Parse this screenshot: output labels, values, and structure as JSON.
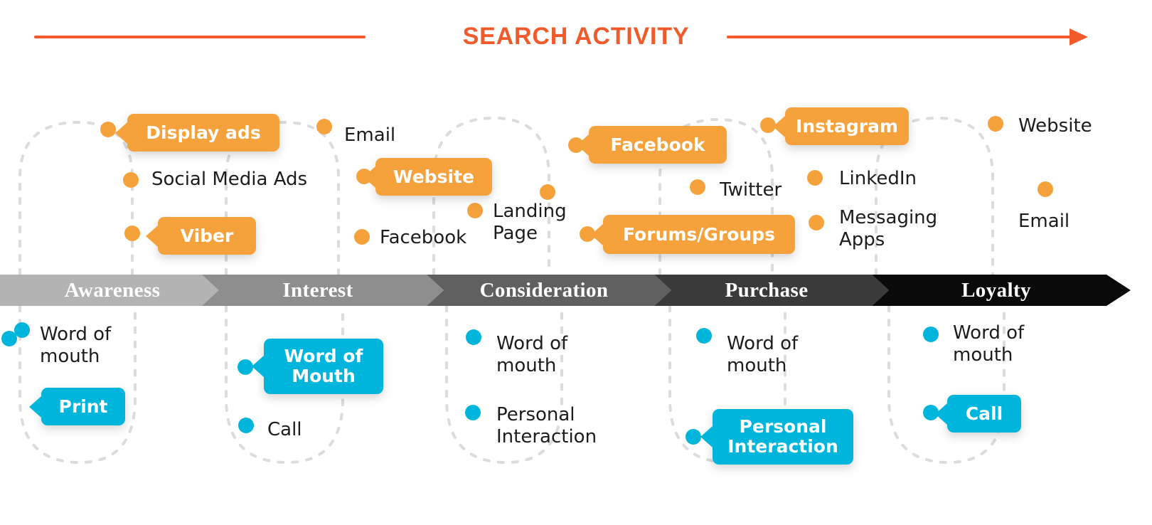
{
  "header": {
    "title": "SEARCH ACTIVITY",
    "accent_color": "#F15B2B",
    "arrow_icon": "right-arrow-icon"
  },
  "colors": {
    "orange": "#F5A23C",
    "cyan": "#00B5DC",
    "title": "#F15B2B",
    "dotted_line": "#DCDCDC"
  },
  "funnel": {
    "stages": [
      {
        "label": "Awareness",
        "color": "#B3B3B3"
      },
      {
        "label": "Interest",
        "color": "#8E8E8E"
      },
      {
        "label": "Consideration",
        "color": "#606060"
      },
      {
        "label": "Purchase",
        "color": "#3A3A3A"
      },
      {
        "label": "Loyalty",
        "color": "#0A0A0A"
      }
    ]
  },
  "chart_data": {
    "type": "diagram",
    "title": "SEARCH ACTIVITY",
    "description": "Customer journey funnel mapping online (above the bar) and offline (below the bar) touchpoints across five stages.",
    "stages": [
      "Awareness",
      "Interest",
      "Consideration",
      "Purchase",
      "Loyalty"
    ],
    "online_touchpoints": {
      "Awareness": [
        "Display ads",
        "Social Media Ads",
        "Viber"
      ],
      "Interest": [
        "Email",
        "Website",
        "Facebook"
      ],
      "Consideration": [
        "Landing Page",
        "Facebook",
        "Forums/Groups"
      ],
      "Purchase": [
        "Twitter",
        "Instagram",
        "LinkedIn",
        "Messaging Apps"
      ],
      "Loyalty": [
        "Website",
        "Email"
      ]
    },
    "offline_touchpoints": {
      "Awareness": [
        "Word of mouth",
        "Print"
      ],
      "Interest": [
        "Word of Mouth",
        "Call"
      ],
      "Consideration": [
        "Word of mouth",
        "Personal Interaction"
      ],
      "Purchase": [
        "Word of mouth",
        "Personal Interaction"
      ],
      "Loyalty": [
        "Word of mouth",
        "Call"
      ]
    },
    "highlighted_online": [
      "Display ads",
      "Viber",
      "Website",
      "Facebook",
      "Forums/Groups",
      "Instagram"
    ],
    "highlighted_offline": [
      "Print",
      "Word of Mouth",
      "Personal Interaction",
      "Call"
    ]
  },
  "top": {
    "labels": [
      {
        "id": "social-media-ads",
        "text": "Social Media Ads"
      },
      {
        "id": "email-interest",
        "text": "Email"
      },
      {
        "id": "facebook-interest",
        "text": "Facebook"
      },
      {
        "id": "landing-page",
        "text": "Landing\nPage"
      },
      {
        "id": "twitter",
        "text": "Twitter"
      },
      {
        "id": "linkedin",
        "text": "LinkedIn"
      },
      {
        "id": "messaging-apps",
        "text": "Messaging\nApps"
      },
      {
        "id": "website-loyalty",
        "text": "Website"
      },
      {
        "id": "email-loyalty",
        "text": "Email"
      }
    ],
    "pills": [
      {
        "id": "display-ads",
        "text": "Display ads"
      },
      {
        "id": "viber",
        "text": "Viber"
      },
      {
        "id": "website",
        "text": "Website"
      },
      {
        "id": "facebook",
        "text": "Facebook"
      },
      {
        "id": "forums-groups",
        "text": "Forums/Groups"
      },
      {
        "id": "instagram",
        "text": "Instagram"
      }
    ]
  },
  "bottom": {
    "labels": [
      {
        "id": "wom-awareness",
        "text": "Word of\nmouth"
      },
      {
        "id": "call-interest",
        "text": "Call"
      },
      {
        "id": "wom-consideration",
        "text": "Word of\nmouth"
      },
      {
        "id": "personal-interaction-consideration",
        "text": "Personal\nInteraction"
      },
      {
        "id": "wom-purchase",
        "text": "Word of\nmouth"
      },
      {
        "id": "wom-loyalty",
        "text": "Word of\nmouth"
      }
    ],
    "pills": [
      {
        "id": "print",
        "text": "Print"
      },
      {
        "id": "word-of-mouth-interest",
        "text": "Word of\nMouth"
      },
      {
        "id": "personal-interaction-purchase",
        "text": "Personal\nInteraction"
      },
      {
        "id": "call-loyalty",
        "text": "Call"
      }
    ]
  }
}
